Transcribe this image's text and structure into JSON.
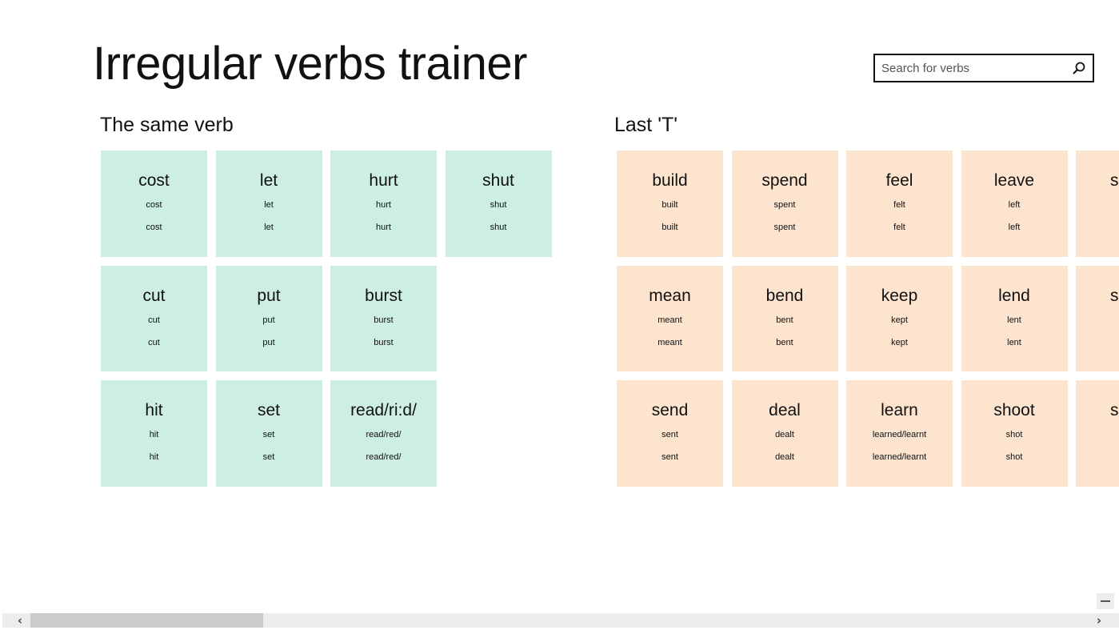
{
  "app": {
    "title": "Irregular verbs trainer"
  },
  "search": {
    "placeholder": "Search for verbs",
    "icon": "search-icon"
  },
  "groups": [
    {
      "title": "The same verb",
      "color": "#cdeee4",
      "tiles": [
        {
          "verb": "cost",
          "past": "cost",
          "participle": "cost"
        },
        {
          "verb": "cut",
          "past": "cut",
          "participle": "cut"
        },
        {
          "verb": "hit",
          "past": "hit",
          "participle": "hit"
        },
        {
          "verb": "let",
          "past": "let",
          "participle": "let"
        },
        {
          "verb": "put",
          "past": "put",
          "participle": "put"
        },
        {
          "verb": "set",
          "past": "set",
          "participle": "set"
        },
        {
          "verb": "hurt",
          "past": "hurt",
          "participle": "hurt"
        },
        {
          "verb": "burst",
          "past": "burst",
          "participle": "burst"
        },
        {
          "verb": "read/ri:d/",
          "past": "read/red/",
          "participle": "read/red/"
        },
        {
          "verb": "shut",
          "past": "shut",
          "participle": "shut"
        }
      ]
    },
    {
      "title": "Last 'T'",
      "color": "#fde4cf",
      "tiles": [
        {
          "verb": "build",
          "past": "built",
          "participle": "built"
        },
        {
          "verb": "mean",
          "past": "meant",
          "participle": "meant"
        },
        {
          "verb": "send",
          "past": "sent",
          "participle": "sent"
        },
        {
          "verb": "spend",
          "past": "spent",
          "participle": "spent"
        },
        {
          "verb": "bend",
          "past": "bent",
          "participle": "bent"
        },
        {
          "verb": "deal",
          "past": "dealt",
          "participle": "dealt"
        },
        {
          "verb": "feel",
          "past": "felt",
          "participle": "felt"
        },
        {
          "verb": "keep",
          "past": "kept",
          "participle": "kept"
        },
        {
          "verb": "learn",
          "past": "learned/learnt",
          "participle": "learned/learnt"
        },
        {
          "verb": "leave",
          "past": "left",
          "participle": "left"
        },
        {
          "verb": "lend",
          "past": "lent",
          "participle": "lent"
        },
        {
          "verb": "shoot",
          "past": "shot",
          "participle": "shot"
        },
        {
          "verb": "s",
          "past": "",
          "participle": "",
          "clipped": true
        },
        {
          "verb": "s",
          "past": "",
          "participle": "",
          "clipped": true
        },
        {
          "verb": "s",
          "past": "",
          "participle": "",
          "clipped": true
        }
      ]
    }
  ],
  "scrollbar": {
    "left_icon": "chevron-left-icon",
    "right_icon": "chevron-right-icon",
    "zoom_icon": "minus-icon",
    "position_fraction": 0.21
  }
}
